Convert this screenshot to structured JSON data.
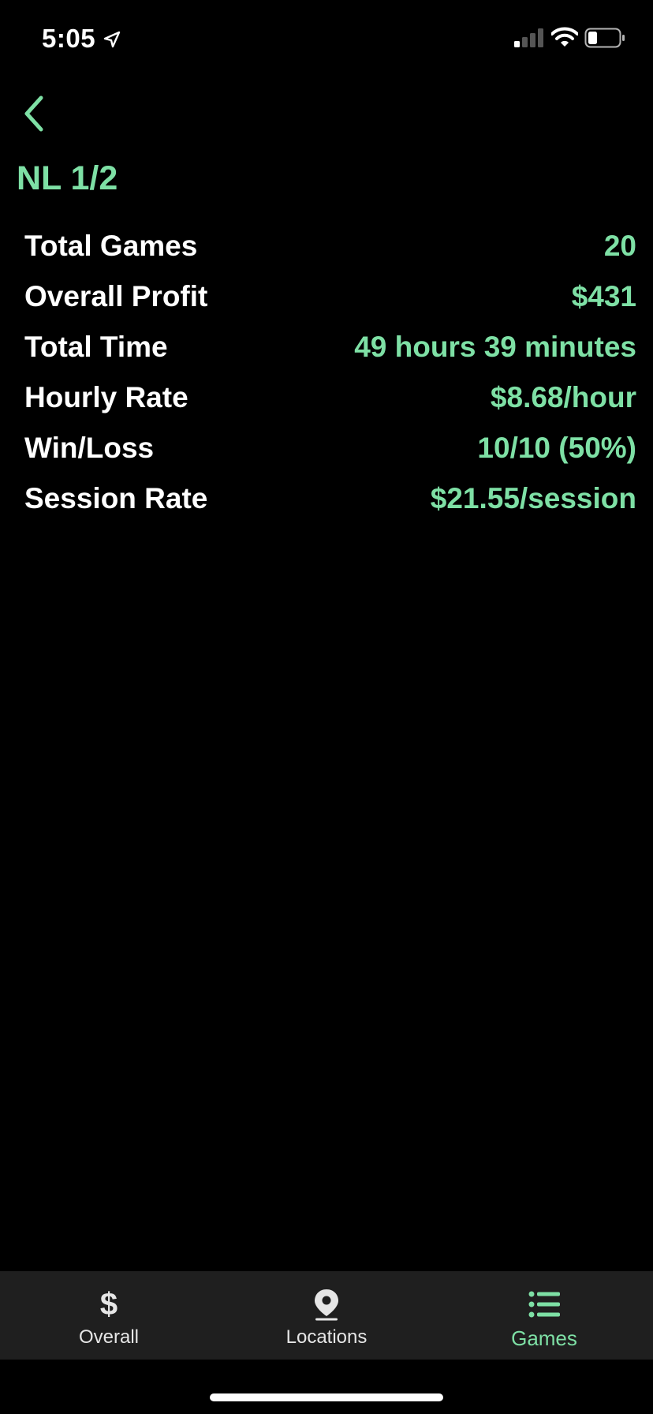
{
  "status_bar": {
    "time": "5:05"
  },
  "nav": {
    "title": "NL 1/2"
  },
  "stats": [
    {
      "label": "Total Games",
      "value": "20"
    },
    {
      "label": "Overall Profit",
      "value": "$431"
    },
    {
      "label": "Total Time",
      "value": "49 hours 39 minutes"
    },
    {
      "label": "Hourly Rate",
      "value": "$8.68/hour"
    },
    {
      "label": "Win/Loss",
      "value": "10/10 (50%)"
    },
    {
      "label": "Session Rate",
      "value": "$21.55/session"
    }
  ],
  "tab_bar": {
    "tabs": [
      {
        "label": "Overall",
        "icon": "dollar-icon"
      },
      {
        "label": "Locations",
        "icon": "map-pin-icon"
      },
      {
        "label": "Games",
        "icon": "list-icon",
        "active": true
      }
    ]
  },
  "colors": {
    "accent": "#7ee0a5",
    "background": "#000000",
    "tab_bar": "#1f1f1f"
  }
}
